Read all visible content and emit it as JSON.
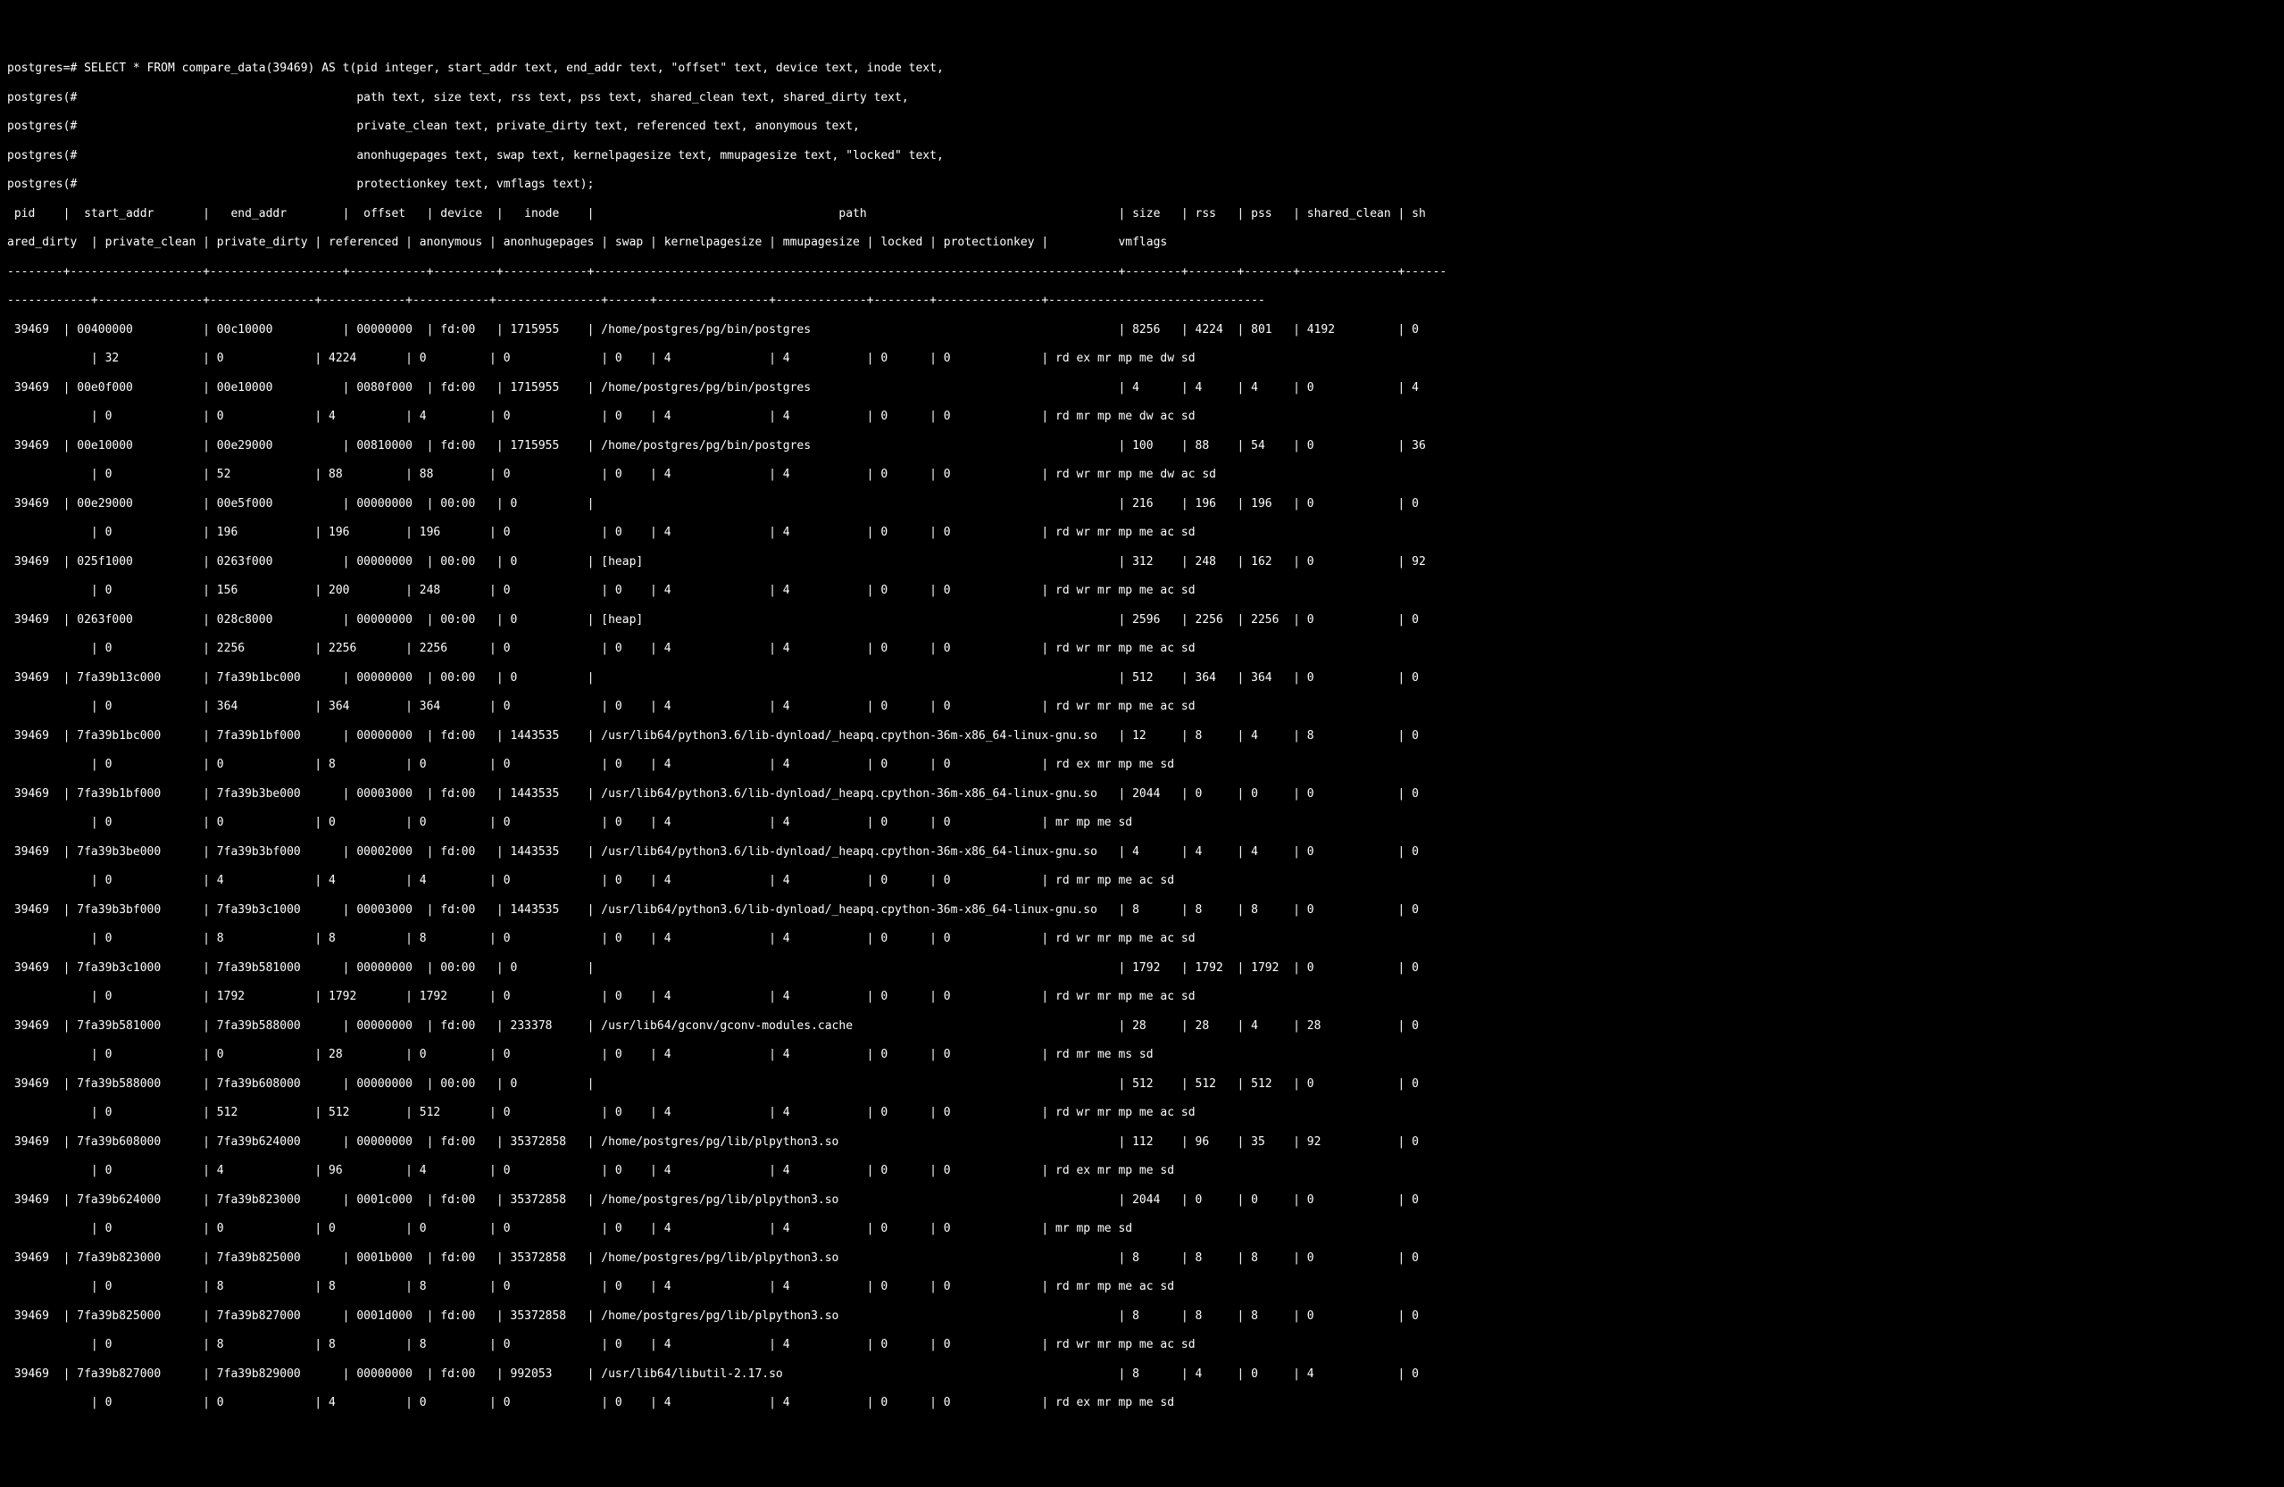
{
  "prompt_lines": [
    "postgres=# SELECT * FROM compare_data(39469) AS t(pid integer, start_addr text, end_addr text, \"offset\" text, device text, inode text,",
    "postgres(#                                        path text, size text, rss text, pss text, shared_clean text, shared_dirty text,",
    "postgres(#                                        private_clean text, private_dirty text, referenced text, anonymous text,",
    "postgres(#                                        anonhugepages text, swap text, kernelpagesize text, mmupagesize text, \"locked\" text,",
    "postgres(#                                        protectionkey text, vmflags text);"
  ],
  "columns": [
    "pid",
    "start_addr",
    "end_addr",
    "offset",
    "device",
    "inode",
    "path",
    "size",
    "rss",
    "pss",
    "shared_clean",
    "shared_dirty",
    "private_clean",
    "private_dirty",
    "referenced",
    "anonymous",
    "anonhugepages",
    "swap",
    "kernelpagesize",
    "mmupagesize",
    "locked",
    "protectionkey",
    "vmflags"
  ],
  "cols_row1": [
    "pid",
    "start_addr",
    "end_addr",
    "offset",
    "device",
    "inode",
    "path",
    "size",
    "rss",
    "pss",
    "shared_clean",
    "sh"
  ],
  "cols_row2": [
    "ared_dirty",
    "private_clean",
    "private_dirty",
    "referenced",
    "anonymous",
    "anonhugepages",
    "swap",
    "kernelpagesize",
    "mmupagesize",
    "locked",
    "protectionkey",
    "vmflags"
  ],
  "rows": [
    {
      "pid": "39469",
      "start_addr": "00400000",
      "end_addr": "00c10000",
      "offset": "00000000",
      "device": "fd:00",
      "inode": "1715955",
      "path": "/home/postgres/pg/bin/postgres",
      "size": "8256",
      "rss": "4224",
      "pss": "801",
      "shared_clean": "4192",
      "shared_dirty": "0",
      "private_clean": "32",
      "private_dirty": "0",
      "referenced": "4224",
      "anonymous": "0",
      "anonhugepages": "0",
      "swap": "0",
      "kernelpagesize": "4",
      "mmupagesize": "4",
      "locked": "0",
      "protectionkey": "0",
      "vmflags": "rd ex mr mp me dw sd"
    },
    {
      "pid": "39469",
      "start_addr": "00e0f000",
      "end_addr": "00e10000",
      "offset": "0080f000",
      "device": "fd:00",
      "inode": "1715955",
      "path": "/home/postgres/pg/bin/postgres",
      "size": "4",
      "rss": "4",
      "pss": "4",
      "shared_clean": "0",
      "shared_dirty": "4",
      "private_clean": "0",
      "private_dirty": "0",
      "referenced": "4",
      "anonymous": "4",
      "anonhugepages": "0",
      "swap": "0",
      "kernelpagesize": "4",
      "mmupagesize": "4",
      "locked": "0",
      "protectionkey": "0",
      "vmflags": "rd mr mp me dw ac sd"
    },
    {
      "pid": "39469",
      "start_addr": "00e10000",
      "end_addr": "00e29000",
      "offset": "00810000",
      "device": "fd:00",
      "inode": "1715955",
      "path": "/home/postgres/pg/bin/postgres",
      "size": "100",
      "rss": "88",
      "pss": "54",
      "shared_clean": "0",
      "shared_dirty": "36",
      "private_clean": "0",
      "private_dirty": "52",
      "referenced": "88",
      "anonymous": "88",
      "anonhugepages": "0",
      "swap": "0",
      "kernelpagesize": "4",
      "mmupagesize": "4",
      "locked": "0",
      "protectionkey": "0",
      "vmflags": "rd wr mr mp me dw ac sd"
    },
    {
      "pid": "39469",
      "start_addr": "00e29000",
      "end_addr": "00e5f000",
      "offset": "00000000",
      "device": "00:00",
      "inode": "0",
      "path": "",
      "size": "216",
      "rss": "196",
      "pss": "196",
      "shared_clean": "0",
      "shared_dirty": "0",
      "private_clean": "0",
      "private_dirty": "196",
      "referenced": "196",
      "anonymous": "196",
      "anonhugepages": "0",
      "swap": "0",
      "kernelpagesize": "4",
      "mmupagesize": "4",
      "locked": "0",
      "protectionkey": "0",
      "vmflags": "rd wr mr mp me ac sd"
    },
    {
      "pid": "39469",
      "start_addr": "025f1000",
      "end_addr": "0263f000",
      "offset": "00000000",
      "device": "00:00",
      "inode": "0",
      "path": "[heap]",
      "size": "312",
      "rss": "248",
      "pss": "162",
      "shared_clean": "0",
      "shared_dirty": "92",
      "private_clean": "0",
      "private_dirty": "156",
      "referenced": "200",
      "anonymous": "248",
      "anonhugepages": "0",
      "swap": "0",
      "kernelpagesize": "4",
      "mmupagesize": "4",
      "locked": "0",
      "protectionkey": "0",
      "vmflags": "rd wr mr mp me ac sd"
    },
    {
      "pid": "39469",
      "start_addr": "0263f000",
      "end_addr": "028c8000",
      "offset": "00000000",
      "device": "00:00",
      "inode": "0",
      "path": "[heap]",
      "size": "2596",
      "rss": "2256",
      "pss": "2256",
      "shared_clean": "0",
      "shared_dirty": "0",
      "private_clean": "0",
      "private_dirty": "2256",
      "referenced": "2256",
      "anonymous": "2256",
      "anonhugepages": "0",
      "swap": "0",
      "kernelpagesize": "4",
      "mmupagesize": "4",
      "locked": "0",
      "protectionkey": "0",
      "vmflags": "rd wr mr mp me ac sd"
    },
    {
      "pid": "39469",
      "start_addr": "7fa39b13c000",
      "end_addr": "7fa39b1bc000",
      "offset": "00000000",
      "device": "00:00",
      "inode": "0",
      "path": "",
      "size": "512",
      "rss": "364",
      "pss": "364",
      "shared_clean": "0",
      "shared_dirty": "0",
      "private_clean": "0",
      "private_dirty": "364",
      "referenced": "364",
      "anonymous": "364",
      "anonhugepages": "0",
      "swap": "0",
      "kernelpagesize": "4",
      "mmupagesize": "4",
      "locked": "0",
      "protectionkey": "0",
      "vmflags": "rd wr mr mp me ac sd"
    },
    {
      "pid": "39469",
      "start_addr": "7fa39b1bc000",
      "end_addr": "7fa39b1bf000",
      "offset": "00000000",
      "device": "fd:00",
      "inode": "1443535",
      "path": "/usr/lib64/python3.6/lib-dynload/_heapq.cpython-36m-x86_64-linux-gnu.so",
      "size": "12",
      "rss": "8",
      "pss": "4",
      "shared_clean": "8",
      "shared_dirty": "0",
      "private_clean": "0",
      "private_dirty": "0",
      "referenced": "8",
      "anonymous": "0",
      "anonhugepages": "0",
      "swap": "0",
      "kernelpagesize": "4",
      "mmupagesize": "4",
      "locked": "0",
      "protectionkey": "0",
      "vmflags": "rd ex mr mp me sd"
    },
    {
      "pid": "39469",
      "start_addr": "7fa39b1bf000",
      "end_addr": "7fa39b3be000",
      "offset": "00003000",
      "device": "fd:00",
      "inode": "1443535",
      "path": "/usr/lib64/python3.6/lib-dynload/_heapq.cpython-36m-x86_64-linux-gnu.so",
      "size": "2044",
      "rss": "0",
      "pss": "0",
      "shared_clean": "0",
      "shared_dirty": "0",
      "private_clean": "0",
      "private_dirty": "0",
      "referenced": "0",
      "anonymous": "0",
      "anonhugepages": "0",
      "swap": "0",
      "kernelpagesize": "4",
      "mmupagesize": "4",
      "locked": "0",
      "protectionkey": "0",
      "vmflags": "mr mp me sd"
    },
    {
      "pid": "39469",
      "start_addr": "7fa39b3be000",
      "end_addr": "7fa39b3bf000",
      "offset": "00002000",
      "device": "fd:00",
      "inode": "1443535",
      "path": "/usr/lib64/python3.6/lib-dynload/_heapq.cpython-36m-x86_64-linux-gnu.so",
      "size": "4",
      "rss": "4",
      "pss": "4",
      "shared_clean": "0",
      "shared_dirty": "0",
      "private_clean": "0",
      "private_dirty": "4",
      "referenced": "4",
      "anonymous": "4",
      "anonhugepages": "0",
      "swap": "0",
      "kernelpagesize": "4",
      "mmupagesize": "4",
      "locked": "0",
      "protectionkey": "0",
      "vmflags": "rd mr mp me ac sd"
    },
    {
      "pid": "39469",
      "start_addr": "7fa39b3bf000",
      "end_addr": "7fa39b3c1000",
      "offset": "00003000",
      "device": "fd:00",
      "inode": "1443535",
      "path": "/usr/lib64/python3.6/lib-dynload/_heapq.cpython-36m-x86_64-linux-gnu.so",
      "size": "8",
      "rss": "8",
      "pss": "8",
      "shared_clean": "0",
      "shared_dirty": "0",
      "private_clean": "0",
      "private_dirty": "8",
      "referenced": "8",
      "anonymous": "8",
      "anonhugepages": "0",
      "swap": "0",
      "kernelpagesize": "4",
      "mmupagesize": "4",
      "locked": "0",
      "protectionkey": "0",
      "vmflags": "rd wr mr mp me ac sd"
    },
    {
      "pid": "39469",
      "start_addr": "7fa39b3c1000",
      "end_addr": "7fa39b581000",
      "offset": "00000000",
      "device": "00:00",
      "inode": "0",
      "path": "",
      "size": "1792",
      "rss": "1792",
      "pss": "1792",
      "shared_clean": "0",
      "shared_dirty": "0",
      "private_clean": "0",
      "private_dirty": "1792",
      "referenced": "1792",
      "anonymous": "1792",
      "anonhugepages": "0",
      "swap": "0",
      "kernelpagesize": "4",
      "mmupagesize": "4",
      "locked": "0",
      "protectionkey": "0",
      "vmflags": "rd wr mr mp me ac sd"
    },
    {
      "pid": "39469",
      "start_addr": "7fa39b581000",
      "end_addr": "7fa39b588000",
      "offset": "00000000",
      "device": "fd:00",
      "inode": "233378",
      "path": "/usr/lib64/gconv/gconv-modules.cache",
      "size": "28",
      "rss": "28",
      "pss": "4",
      "shared_clean": "28",
      "shared_dirty": "0",
      "private_clean": "0",
      "private_dirty": "0",
      "referenced": "28",
      "anonymous": "0",
      "anonhugepages": "0",
      "swap": "0",
      "kernelpagesize": "4",
      "mmupagesize": "4",
      "locked": "0",
      "protectionkey": "0",
      "vmflags": "rd mr me ms sd"
    },
    {
      "pid": "39469",
      "start_addr": "7fa39b588000",
      "end_addr": "7fa39b608000",
      "offset": "00000000",
      "device": "00:00",
      "inode": "0",
      "path": "",
      "size": "512",
      "rss": "512",
      "pss": "512",
      "shared_clean": "0",
      "shared_dirty": "0",
      "private_clean": "0",
      "private_dirty": "512",
      "referenced": "512",
      "anonymous": "512",
      "anonhugepages": "0",
      "swap": "0",
      "kernelpagesize": "4",
      "mmupagesize": "4",
      "locked": "0",
      "protectionkey": "0",
      "vmflags": "rd wr mr mp me ac sd"
    },
    {
      "pid": "39469",
      "start_addr": "7fa39b608000",
      "end_addr": "7fa39b624000",
      "offset": "00000000",
      "device": "fd:00",
      "inode": "35372858",
      "path": "/home/postgres/pg/lib/plpython3.so",
      "size": "112",
      "rss": "96",
      "pss": "35",
      "shared_clean": "92",
      "shared_dirty": "0",
      "private_clean": "0",
      "private_dirty": "4",
      "referenced": "96",
      "anonymous": "4",
      "anonhugepages": "0",
      "swap": "0",
      "kernelpagesize": "4",
      "mmupagesize": "4",
      "locked": "0",
      "protectionkey": "0",
      "vmflags": "rd ex mr mp me sd"
    },
    {
      "pid": "39469",
      "start_addr": "7fa39b624000",
      "end_addr": "7fa39b823000",
      "offset": "0001c000",
      "device": "fd:00",
      "inode": "35372858",
      "path": "/home/postgres/pg/lib/plpython3.so",
      "size": "2044",
      "rss": "0",
      "pss": "0",
      "shared_clean": "0",
      "shared_dirty": "0",
      "private_clean": "0",
      "private_dirty": "0",
      "referenced": "0",
      "anonymous": "0",
      "anonhugepages": "0",
      "swap": "0",
      "kernelpagesize": "4",
      "mmupagesize": "4",
      "locked": "0",
      "protectionkey": "0",
      "vmflags": "mr mp me sd"
    },
    {
      "pid": "39469",
      "start_addr": "7fa39b823000",
      "end_addr": "7fa39b825000",
      "offset": "0001b000",
      "device": "fd:00",
      "inode": "35372858",
      "path": "/home/postgres/pg/lib/plpython3.so",
      "size": "8",
      "rss": "8",
      "pss": "8",
      "shared_clean": "0",
      "shared_dirty": "0",
      "private_clean": "0",
      "private_dirty": "8",
      "referenced": "8",
      "anonymous": "8",
      "anonhugepages": "0",
      "swap": "0",
      "kernelpagesize": "4",
      "mmupagesize": "4",
      "locked": "0",
      "protectionkey": "0",
      "vmflags": "rd mr mp me ac sd"
    },
    {
      "pid": "39469",
      "start_addr": "7fa39b825000",
      "end_addr": "7fa39b827000",
      "offset": "0001d000",
      "device": "fd:00",
      "inode": "35372858",
      "path": "/home/postgres/pg/lib/plpython3.so",
      "size": "8",
      "rss": "8",
      "pss": "8",
      "shared_clean": "0",
      "shared_dirty": "0",
      "private_clean": "0",
      "private_dirty": "8",
      "referenced": "8",
      "anonymous": "8",
      "anonhugepages": "0",
      "swap": "0",
      "kernelpagesize": "4",
      "mmupagesize": "4",
      "locked": "0",
      "protectionkey": "0",
      "vmflags": "rd wr mr mp me ac sd"
    },
    {
      "pid": "39469",
      "start_addr": "7fa39b827000",
      "end_addr": "7fa39b829000",
      "offset": "00000000",
      "device": "fd:00",
      "inode": "992053",
      "path": "/usr/lib64/libutil-2.17.so",
      "size": "8",
      "rss": "4",
      "pss": "0",
      "shared_clean": "4",
      "shared_dirty": "0",
      "private_clean": "0",
      "private_dirty": "0",
      "referenced": "4",
      "anonymous": "0",
      "anonhugepages": "0",
      "swap": "0",
      "kernelpagesize": "4",
      "mmupagesize": "4",
      "locked": "0",
      "protectionkey": "0",
      "vmflags": "rd ex mr mp me sd"
    }
  ]
}
